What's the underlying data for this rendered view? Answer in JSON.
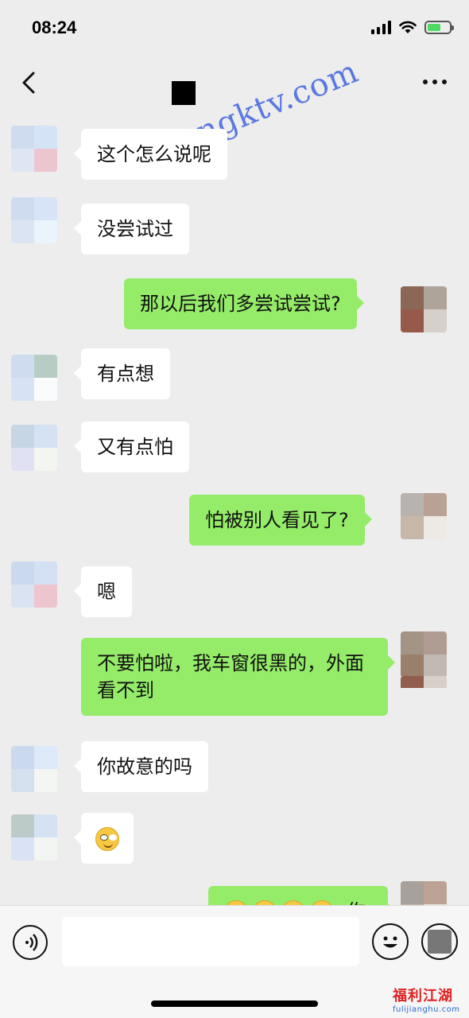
{
  "status_bar": {
    "time": "08:24"
  },
  "watermark": "sifangktv.com",
  "messages": [
    {
      "side": "in",
      "text": "这个怎么说呢"
    },
    {
      "side": "in",
      "text": "没尝试过"
    },
    {
      "side": "out",
      "text": "那以后我们多尝试尝试?"
    },
    {
      "side": "in",
      "text": "有点想"
    },
    {
      "side": "in",
      "text": "又有点怕"
    },
    {
      "side": "out",
      "text": "怕被别人看见了?"
    },
    {
      "side": "in",
      "text": "嗯"
    },
    {
      "side": "out",
      "text": "不要怕啦，我车窗很黑的，外面看不到"
    },
    {
      "side": "in",
      "text": "你故意的吗"
    },
    {
      "side": "in",
      "emoji": "smiling-glasses-emoji"
    },
    {
      "side": "out",
      "text": "作猪"
    }
  ],
  "logo": {
    "main": "福利江湖",
    "sub": "fulijianghu.com"
  },
  "colors": {
    "background": "#ededed",
    "outgoing_bubble": "#95ec69",
    "incoming_bubble": "#ffffff"
  }
}
